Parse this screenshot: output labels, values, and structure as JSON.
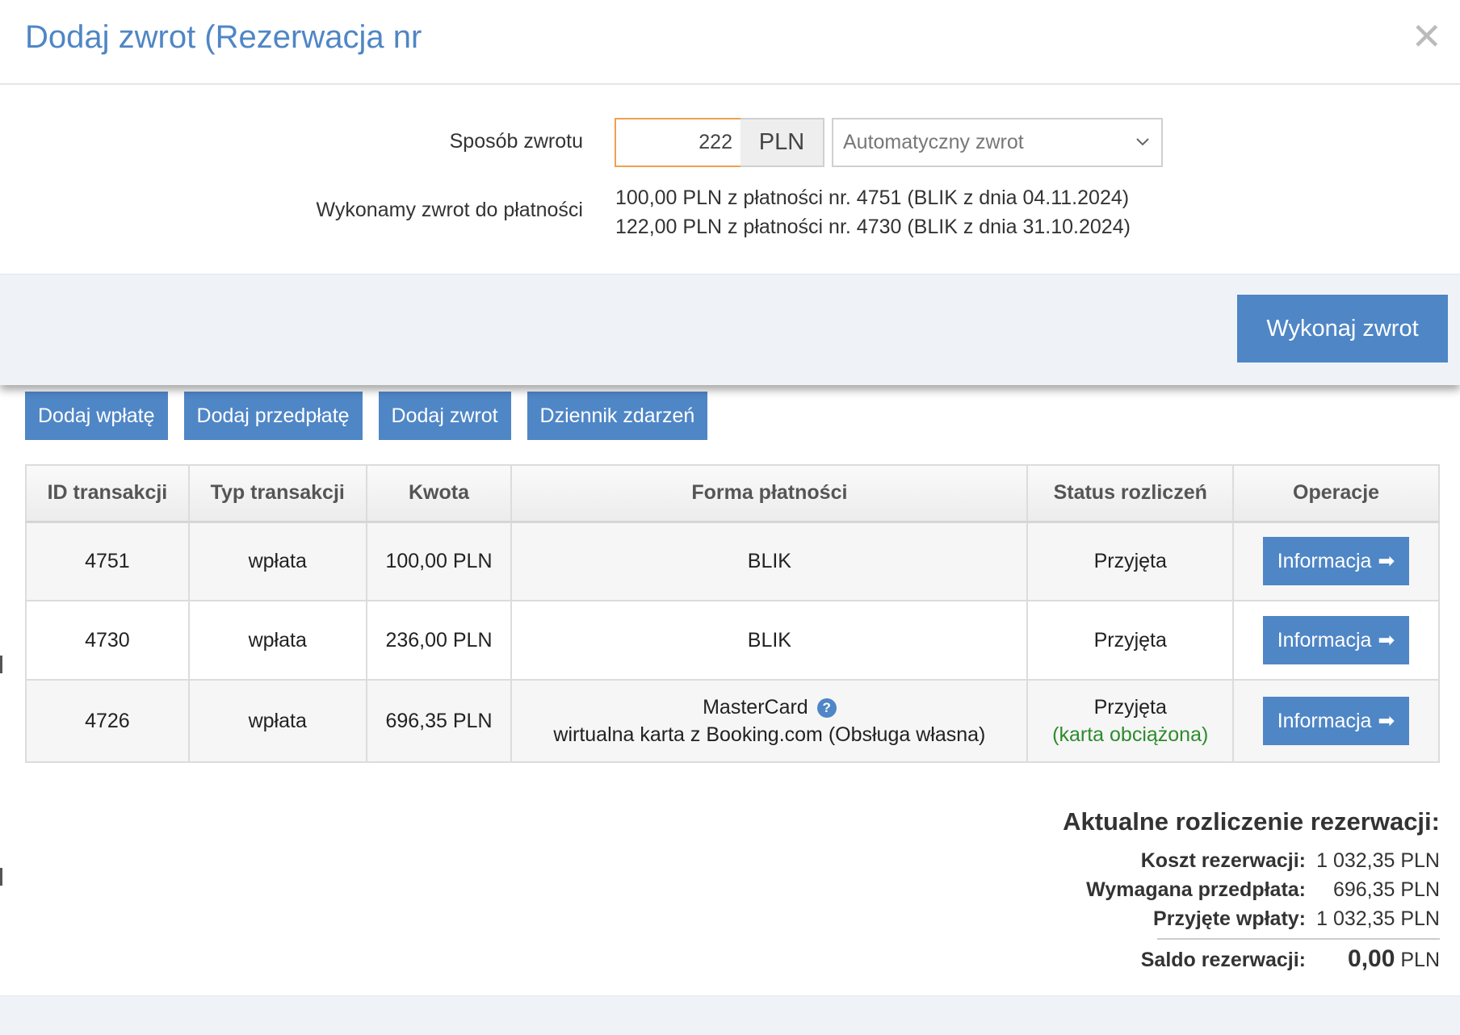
{
  "modal": {
    "title": "Dodaj zwrot (Rezerwacja nr",
    "close_symbol": "✕",
    "method_label": "Sposób zwrotu",
    "amount_value": "222",
    "currency": "PLN",
    "method_selected": "Automatyczny zwrot",
    "refund_to_label": "Wykonamy zwrot do płatności",
    "refund_lines": [
      "100,00 PLN z płatności nr. 4751 (BLIK z dnia 04.11.2024)",
      "122,00 PLN z płatności nr. 4730 (BLIK z dnia 31.10.2024)"
    ],
    "submit_label": "Wykonaj zwrot"
  },
  "actions": {
    "add_payment": "Dodaj wpłatę",
    "add_prepayment": "Dodaj przedpłatę",
    "add_refund": "Dodaj zwrot",
    "event_log": "Dziennik zdarzeń"
  },
  "table": {
    "headers": [
      "ID transakcji",
      "Typ transakcji",
      "Kwota",
      "Forma płatności",
      "Status rozliczeń",
      "Operacje"
    ],
    "rows": [
      {
        "id": "4751",
        "type": "wpłata",
        "amount": "100,00 PLN",
        "method": "BLIK",
        "method_note": "",
        "status": "Przyjęta",
        "status_note": "",
        "action": "Informacja"
      },
      {
        "id": "4730",
        "type": "wpłata",
        "amount": "236,00 PLN",
        "method": "BLIK",
        "method_note": "",
        "status": "Przyjęta",
        "status_note": "",
        "action": "Informacja"
      },
      {
        "id": "4726",
        "type": "wpłata",
        "amount": "696,35 PLN",
        "method": "MasterCard",
        "method_note": "wirtualna karta z Booking.com (Obsługa własna)",
        "status": "Przyjęta",
        "status_note": "(karta obciążona)",
        "action": "Informacja"
      }
    ],
    "help_symbol": "?",
    "arrow_symbol": "➡"
  },
  "summary": {
    "title": "Aktualne rozliczenie rezerwacji:",
    "cost_label": "Koszt rezerwacji:",
    "cost_value": "1 032,35 PLN",
    "required_prepayment_label": "Wymagana przedpłata:",
    "required_prepayment_value": "696,35 PLN",
    "received_label": "Przyjęte wpłaty:",
    "received_value": "1 032,35 PLN",
    "balance_label": "Saldo rezerwacji:",
    "balance_amount": "0,00",
    "balance_currency": "PLN"
  },
  "colors": {
    "accent": "#4f86c6",
    "input_focus": "#f0a050",
    "status_ok": "#2e8b2e",
    "footer_bg": "#eff3f8"
  }
}
